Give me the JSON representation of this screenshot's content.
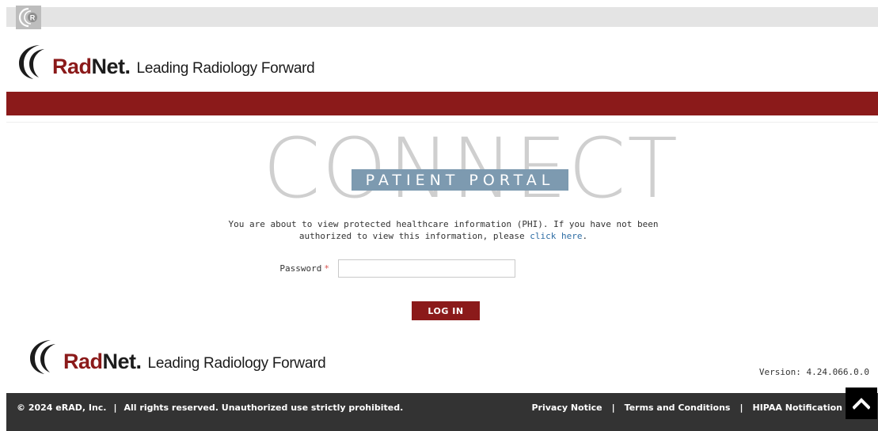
{
  "topbar": {
    "logo_icon": "radnet-r-icon"
  },
  "header": {
    "brand_rad": "Rad",
    "brand_net": "Net",
    "brand_dot": ".",
    "tagline": "Leading Radiology Forward"
  },
  "hero": {
    "connect_text": "CONNECT",
    "portal_label": "PATIENT PORTAL"
  },
  "notice": {
    "text_before": "You are about to view protected healthcare information (PHI). If you have not been authorized to view this information, please ",
    "link_text": "click here",
    "text_after": "."
  },
  "form": {
    "password_label": "Password",
    "required_mark": "*",
    "password_value": "",
    "login_label": "LOG IN"
  },
  "footer_logo": {
    "brand_rad": "Rad",
    "brand_net": "Net",
    "brand_dot": ".",
    "tagline": "Leading Radiology Forward"
  },
  "version": "Version: 4.24.066.0.0",
  "footer": {
    "copyright": "© 2024 eRAD, Inc.",
    "separator": "|",
    "rights": "All rights reserved. Unauthorized use strictly prohibited.",
    "links": [
      "Privacy Notice",
      "Terms and Conditions",
      "HIPAA Notification"
    ]
  },
  "colors": {
    "brand_red": "#8b1a1a",
    "portal_blue": "#7d9ab0",
    "footer_bg": "#333333",
    "link_blue": "#2e6da4"
  },
  "icons": {
    "scroll_top": "chevron-up-icon"
  }
}
